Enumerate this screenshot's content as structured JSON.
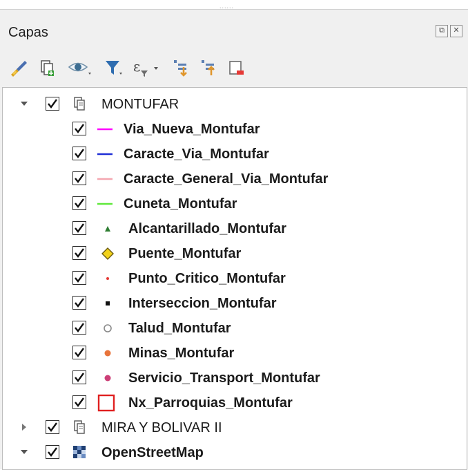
{
  "panel": {
    "title": "Capas"
  },
  "window_buttons": [
    {
      "icon": "float-icon"
    },
    {
      "icon": "close-icon"
    }
  ],
  "toolbar": [
    {
      "icon": "style-brush-icon"
    },
    {
      "icon": "add-group-icon"
    },
    {
      "icon": "eye-visibility-icon"
    },
    {
      "icon": "filter-icon"
    },
    {
      "icon": "expression-filter-icon"
    },
    {
      "icon": "expand-all-icon"
    },
    {
      "icon": "collapse-all-icon"
    },
    {
      "icon": "remove-layer-icon"
    }
  ],
  "tree": {
    "groups": [
      {
        "name": "MONTUFAR",
        "expanded": true,
        "checked": true,
        "layers": [
          {
            "name": "Via_Nueva_Montufar",
            "checked": true,
            "symbol": "line",
            "color": "#ff00ff"
          },
          {
            "name": "Caracte_Via_Montufar",
            "checked": true,
            "symbol": "line",
            "color": "#1f2fd6"
          },
          {
            "name": "Caracte_General_Via_Montufar",
            "checked": true,
            "symbol": "line",
            "color": "#f4a6b0"
          },
          {
            "name": "Cuneta_Montufar",
            "checked": true,
            "symbol": "line",
            "color": "#5fe83a"
          },
          {
            "name": "Alcantarillado_Montufar",
            "checked": true,
            "symbol": "triangle",
            "color": "#2e7d32"
          },
          {
            "name": "Puente_Montufar",
            "checked": true,
            "symbol": "diamond",
            "color": "#f2d21b"
          },
          {
            "name": "Punto_Critico_Montufar",
            "checked": true,
            "symbol": "small-dot",
            "color": "#e53935"
          },
          {
            "name": "Interseccion_Montufar",
            "checked": true,
            "symbol": "square",
            "color": "#111111"
          },
          {
            "name": "Talud_Montufar",
            "checked": true,
            "symbol": "ring",
            "color": "#8a8a8a"
          },
          {
            "name": "Minas_Montufar",
            "checked": true,
            "symbol": "dot",
            "color": "#e8743b"
          },
          {
            "name": "Servicio_Transport_Montufar",
            "checked": true,
            "symbol": "dot",
            "color": "#cc3f77"
          },
          {
            "name": "Nx_Parroquias_Montufar",
            "checked": true,
            "symbol": "polygon",
            "color": "#e02020"
          }
        ]
      },
      {
        "name": "MIRA Y BOLIVAR II",
        "expanded": false,
        "checked": true,
        "layers": []
      }
    ],
    "basemap": {
      "name": "OpenStreetMap",
      "expanded": true,
      "checked": true
    }
  }
}
